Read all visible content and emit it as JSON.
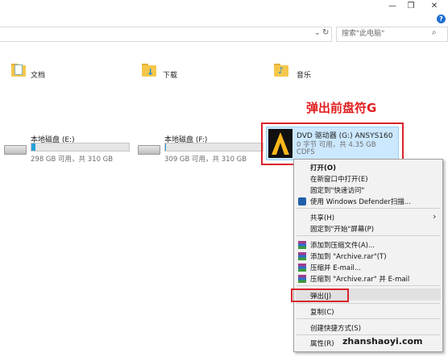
{
  "window": {
    "minimize_glyph": "—",
    "maximize_glyph": "❐",
    "close_glyph": "✕",
    "help_glyph": "?"
  },
  "address": {
    "search_placeholder": "搜索\"此电脑\""
  },
  "folders": [
    {
      "label": "文档",
      "icon": "document-folder-icon"
    },
    {
      "label": "下载",
      "icon": "download-folder-icon"
    },
    {
      "label": "音乐",
      "icon": "music-folder-icon"
    }
  ],
  "drives": [
    {
      "label": "本地磁盘 (E:)",
      "free": "298 GB 可用，共 310 GB",
      "used_fraction": 0.04
    },
    {
      "label": "本地磁盘 (F:)",
      "free": "309 GB 可用，共 310 GB",
      "used_fraction": 0.003
    },
    {
      "label": "DVD 驱动器 (G:) ANSYS160",
      "free": "0 字节 可用，共 4.35 GB",
      "fs": "CDFS"
    }
  ],
  "annotation": "弹出前盘符G",
  "context_menu": {
    "items": [
      "打开(O)",
      "在新窗口中打开(E)",
      "固定到\"快速访问\"",
      "使用 Windows Defender扫描...",
      "共享(H)",
      "固定到\"开始\"屏幕(P)",
      "添加到压缩文件(A)...",
      "添加到 \"Archive.rar\"(T)",
      "压缩并 E-mail...",
      "压缩到 \"Archive.rar\" 并 E-mail",
      "弹出(J)",
      "复制(C)",
      "创建快捷方式(S)",
      "属性(R)"
    ],
    "submenu_arrow": "›"
  },
  "watermark": "zhanshaoyi.com",
  "colors": {
    "annotation_red": "#e21f1f",
    "selection_blue": "#cce8ff",
    "bar_blue": "#26a0da",
    "folder_yellow": "#f5c74b"
  }
}
